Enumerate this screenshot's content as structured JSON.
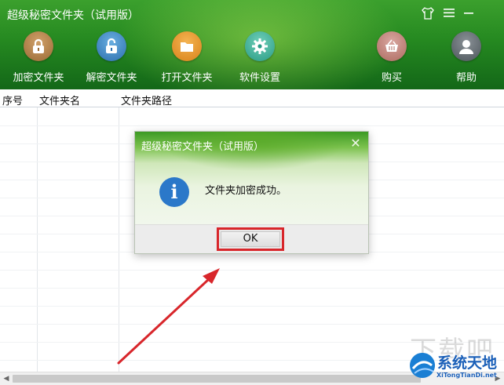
{
  "app": {
    "title": "超级秘密文件夹（试用版）"
  },
  "window_controls": {
    "skin_icon": "tshirt-icon",
    "menu_icon": "hamburger-menu-icon",
    "minimize_icon": "minimize-icon"
  },
  "toolbar": [
    {
      "label": "加密文件夹",
      "icon": "padlock-closed-icon",
      "color": "#b07d45"
    },
    {
      "label": "解密文件夹",
      "icon": "padlock-open-icon",
      "color": "#3b82c4"
    },
    {
      "label": "打开文件夹",
      "icon": "folder-icon",
      "color": "#f0a030"
    },
    {
      "label": "软件设置",
      "icon": "gear-icon",
      "color": "#3aad93"
    },
    {
      "label": "购买",
      "icon": "shopping-basket-icon",
      "color": "#c07b70"
    },
    {
      "label": "帮助",
      "icon": "user-avatar-icon",
      "color": "#5b646b"
    }
  ],
  "table": {
    "columns": [
      "序号",
      "文件夹名",
      "文件夹路径"
    ],
    "rows": []
  },
  "dialog": {
    "title": "超级秘密文件夹（试用版）",
    "message": "文件夹加密成功。",
    "icon": "info-icon",
    "ok_label": "OK",
    "highlight_color": "#d8262b"
  },
  "watermark": {
    "big_text": "下载吧",
    "title": "系统天地",
    "url": "XiTongTianDi.net"
  },
  "colors": {
    "header_green": "#1f8a1a",
    "annotation_red": "#d8262b",
    "info_blue": "#2b78c9"
  }
}
